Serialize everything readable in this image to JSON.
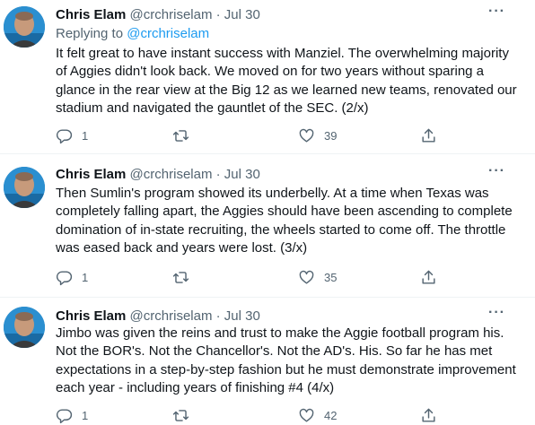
{
  "tweets": [
    {
      "author": {
        "name": "Chris Elam",
        "handle": "@crchriselam"
      },
      "separator": "·",
      "date": "Jul 30",
      "reply_to": {
        "prefix": "Replying to",
        "handle": "@crchriselam"
      },
      "text": "It felt great to have instant success with Manziel. The overwhelming majority of Aggies didn't look back. We moved on for two years without sparing a glance in the rear view at the Big 12 as we learned new teams, renovated our stadium and navigated the gauntlet of the SEC. (2/x)",
      "more_icon": "···",
      "actions": {
        "reply_count": "1",
        "retweet_count": "",
        "like_count": "39"
      }
    },
    {
      "author": {
        "name": "Chris Elam",
        "handle": "@crchriselam"
      },
      "separator": "·",
      "date": "Jul 30",
      "text": "Then Sumlin's program showed its underbelly. At a time when Texas was completely falling apart, the Aggies should have been ascending to complete domination of in-state recruiting, the wheels started to come off. The throttle was eased back and years were lost. (3/x)",
      "more_icon": "···",
      "actions": {
        "reply_count": "1",
        "retweet_count": "",
        "like_count": "35"
      }
    },
    {
      "author": {
        "name": "Chris Elam",
        "handle": "@crchriselam"
      },
      "separator": "·",
      "date": "Jul 30",
      "text": "Jimbo was given the reins and trust to make the Aggie football program his. Not the BOR's. Not the Chancellor's. Not the AD's. His. So far he has met expectations in a step-by-step fashion but he must demonstrate improvement each year - including years of finishing #4 (4/x)",
      "more_icon": "···",
      "actions": {
        "reply_count": "1",
        "retweet_count": "",
        "like_count": "42"
      }
    }
  ],
  "icons": {
    "reply": "reply-icon",
    "retweet": "retweet-icon",
    "like": "heart-icon",
    "share": "share-icon",
    "more": "more-icon"
  },
  "colors": {
    "text": "#0f1419",
    "secondary": "#536471",
    "link": "#1d9bf0",
    "divider": "#eff3f4",
    "avatar_bg": "#1d7fbf"
  }
}
